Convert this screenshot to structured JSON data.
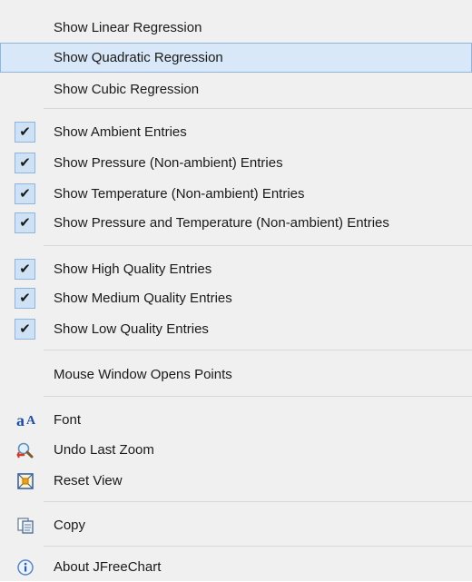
{
  "menu": {
    "regression": [
      {
        "label": "Show Linear Regression",
        "checked": false,
        "hovered": false
      },
      {
        "label": "Show Quadratic Regression",
        "checked": false,
        "hovered": true
      },
      {
        "label": "Show Cubic Regression",
        "checked": false,
        "hovered": false
      }
    ],
    "entries": [
      {
        "label": "Show Ambient Entries",
        "checked": true
      },
      {
        "label": "Show Pressure (Non-ambient) Entries",
        "checked": true
      },
      {
        "label": "Show Temperature (Non-ambient) Entries",
        "checked": true
      },
      {
        "label": "Show Pressure and Temperature (Non-ambient) Entries",
        "checked": true
      }
    ],
    "quality": [
      {
        "label": "Show High Quality Entries",
        "checked": true
      },
      {
        "label": "Show Medium Quality Entries",
        "checked": true
      },
      {
        "label": "Show Low Quality Entries",
        "checked": true
      }
    ],
    "mouse_window": {
      "label": "Mouse Window Opens Points"
    },
    "view": [
      {
        "label": "Font",
        "icon": "font-icon"
      },
      {
        "label": "Undo Last Zoom",
        "icon": "undo-zoom-icon"
      },
      {
        "label": "Reset View",
        "icon": "reset-view-icon"
      }
    ],
    "copy": {
      "label": "Copy",
      "icon": "copy-icon"
    },
    "about": {
      "label": "About JFreeChart",
      "icon": "info-icon"
    }
  },
  "check_glyph": "✔",
  "colors": {
    "menu_bg": "#f0f0f0",
    "hover_bg": "#d9e8f8",
    "hover_border": "#8fb4dd",
    "check_bg": "#cfe2f5"
  }
}
